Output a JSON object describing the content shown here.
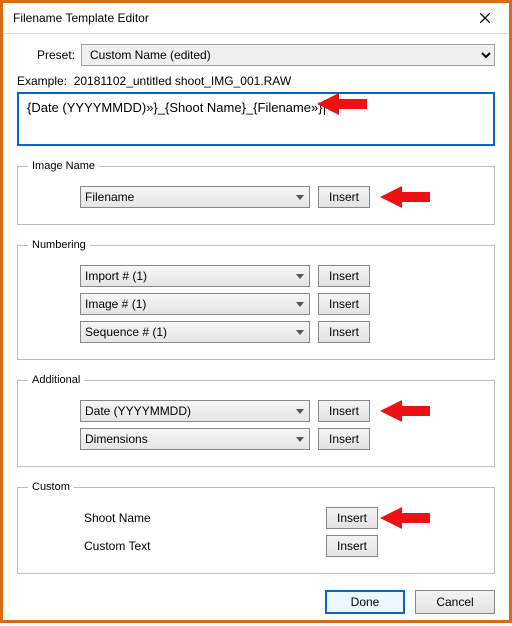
{
  "window": {
    "title": "Filename Template Editor"
  },
  "preset": {
    "label": "Preset:",
    "value": "Custom Name (edited)"
  },
  "example": {
    "label": "Example:",
    "value": "20181102_untitled shoot_IMG_001.RAW"
  },
  "template_text": "{Date (YYYYMMDD)»}_{Shoot Name}_{Filename»}",
  "groups": {
    "image_name": {
      "legend": "Image Name",
      "rows": [
        {
          "dropdown": "Filename",
          "insert": "Insert"
        }
      ]
    },
    "numbering": {
      "legend": "Numbering",
      "rows": [
        {
          "dropdown": "Import # (1)",
          "insert": "Insert"
        },
        {
          "dropdown": "Image # (1)",
          "insert": "Insert"
        },
        {
          "dropdown": "Sequence # (1)",
          "insert": "Insert"
        }
      ]
    },
    "additional": {
      "legend": "Additional",
      "rows": [
        {
          "dropdown": "Date (YYYYMMDD)",
          "insert": "Insert"
        },
        {
          "dropdown": "Dimensions",
          "insert": "Insert"
        }
      ]
    },
    "custom": {
      "legend": "Custom",
      "rows": [
        {
          "label": "Shoot Name",
          "insert": "Insert"
        },
        {
          "label": "Custom Text",
          "insert": "Insert"
        }
      ]
    }
  },
  "buttons": {
    "done": "Done",
    "cancel": "Cancel"
  }
}
